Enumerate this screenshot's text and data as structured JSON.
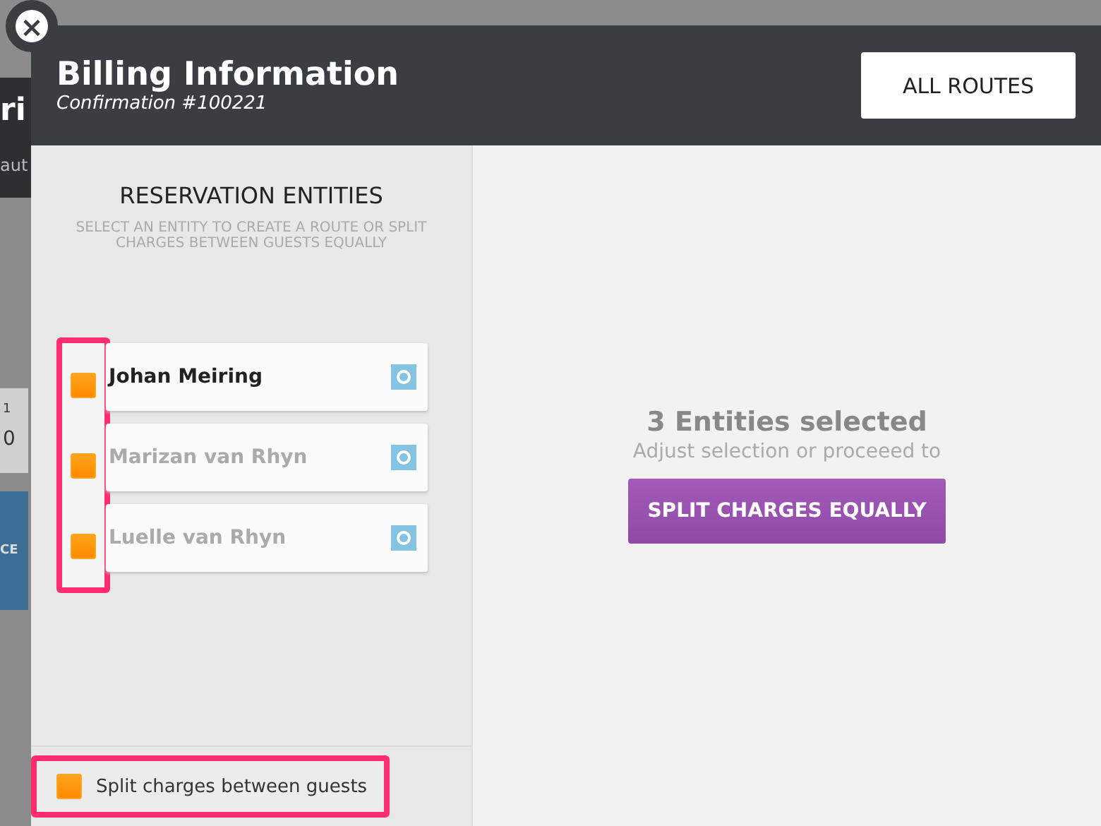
{
  "background_page": {
    "fragments": [
      "ri",
      "aut",
      "1",
      "0",
      "CE"
    ]
  },
  "dialog": {
    "title": "Billing Information",
    "subtitle": "Confirmation #100221",
    "close_icon": "×",
    "all_routes_button": "ALL ROUTES"
  },
  "entities_panel": {
    "heading": "RESERVATION ENTITIES",
    "instructions": "SELECT AN ENTITY TO CREATE A ROUTE OR SPLIT CHARGES BETWEEN GUESTS EQUALLY",
    "entities": [
      {
        "name": "Johan Meiring",
        "checked": true,
        "selected": true
      },
      {
        "name": "Marizan van Rhyn",
        "checked": true,
        "selected": false
      },
      {
        "name": "Luelle van Rhyn",
        "checked": true,
        "selected": false
      }
    ],
    "split_option": {
      "label": "Split charges between guests",
      "checked": true
    }
  },
  "summary": {
    "heading": "3 Entities selected",
    "hint": "Adjust selection or proceeed to",
    "button": "SPLIT CHARGES EQUALLY"
  }
}
